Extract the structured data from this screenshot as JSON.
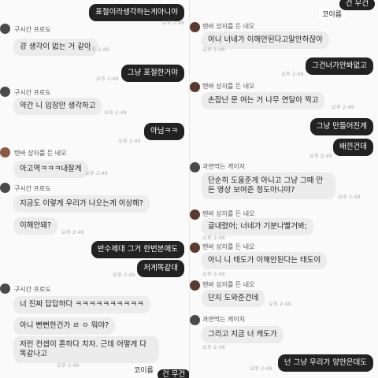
{
  "left": {
    "messages": [
      {
        "id": "l1",
        "text": "표절이라생각하는게아니야",
        "time": "오후 2:49"
      },
      {
        "id": "l2",
        "name": "구시간 프로도",
        "text": "걍 생각이 없는 거 같아",
        "time": "오후 2:49"
      },
      {
        "id": "l3",
        "text": "그냥 표절한거야",
        "time": "오후 2:49"
      },
      {
        "id": "l4",
        "name": "구시간 프로도",
        "text": "약간 니 입장만 생각하고",
        "time": "오후 2:49"
      },
      {
        "id": "l5",
        "text": "아님ㅋㅋ",
        "time": "오후 2:49"
      },
      {
        "id": "l6",
        "name": "텐바 상자를 든 네오",
        "text": "아고역ㅋㅋㅋ내잘게",
        "time": "오후 2:49"
      },
      {
        "id": "l7",
        "name": "구시간 프로도",
        "text": "지금도 이렇게 우리가 나오는게 이상해?",
        "time": ""
      },
      {
        "id": "l8",
        "text": "이해안돼?",
        "time": "오후 2:49"
      },
      {
        "id": "l9",
        "text": "반수제대 그거 한번본애도",
        "time": ""
      },
      {
        "id": "l10",
        "text": "저게똑같대",
        "time": "오후 2:49"
      },
      {
        "id": "l11",
        "name": "구시간 프로도",
        "text": "너 진짜 답답하다 ㅋㅋㅋㅋㅋㅋㅋㅋㅋㅋ",
        "time": ""
      },
      {
        "id": "l12",
        "text": "아니 뻔뻔한건가 ㄹ ㅇ 뭐야?",
        "time": ""
      },
      {
        "id": "l13",
        "text": "저런 컨셉이 흔하다 치자. 근데 어떻게 다 똑같나고",
        "time": "오후 2:49"
      }
    ],
    "watermark": "코이름",
    "partial_bubble": "건 무건"
  },
  "right": {
    "top_partial": "건 무건",
    "top_watermark": "코이름",
    "messages": [
      {
        "id": "r1",
        "name": "텐바 상자를 든 네오",
        "text": "아니 너네가 이해안된다고말안하잖아",
        "time": "오후 2:49"
      },
      {
        "id": "r2",
        "text": "그건너가안봐없고",
        "time": "오후 2:49"
      },
      {
        "id": "r3",
        "name": "텐바 상자를 든 네오",
        "text": "손잡난 문 여는 거 나무 연달아 찍고",
        "time": "오후 2:49"
      },
      {
        "id": "r4",
        "text": "그냥 만들어진게",
        "time": ""
      },
      {
        "id": "r5",
        "text": "배낀건데",
        "time": "오후 2:49"
      },
      {
        "id": "r6",
        "name": "과면먹는 게이지",
        "text": "단순히 도움준게 아니고 그냥 그때 만든 영상 보여준 정도아니야?",
        "time": "오후 2:49"
      },
      {
        "id": "r7",
        "name": "텐바 상자를 든 네오",
        "text": "글내렸어; 너네가 기분나빨거봐;",
        "time": "오후 2:49"
      },
      {
        "id": "r8",
        "name": "텐바 상자를 든 네오",
        "text": "아니 니 태도가 이해안된다는 태도야",
        "time": "오후 2:49"
      },
      {
        "id": "r9",
        "name": "텐바 상자를 든 네오",
        "text": "단지 도와준건데",
        "time": "오후 2:49"
      },
      {
        "id": "r10",
        "name": "과면먹는 게이지",
        "text": "그리고 지금 너 캐도가",
        "time": "오후 2:49"
      },
      {
        "id": "r11",
        "text": "넌 그냥 우리가 양안은데도",
        "time": "오후 2:49"
      }
    ]
  },
  "colors": {
    "outgoing": "#222222",
    "incoming": "#ececec",
    "background": "#fafafa"
  }
}
